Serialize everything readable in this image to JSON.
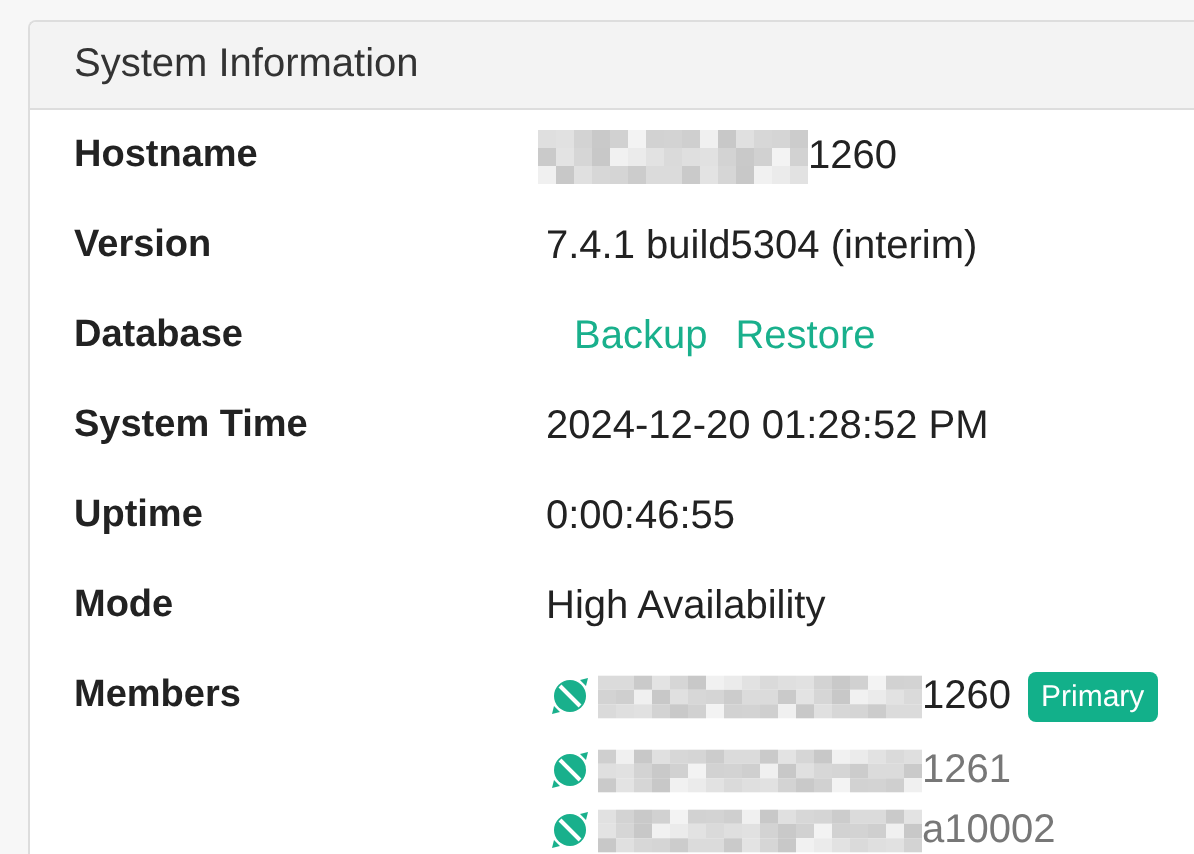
{
  "panel": {
    "title": "System Information"
  },
  "rows": [
    {
      "kind": "text",
      "label": "Hostname",
      "value": "1260",
      "redacted": true
    },
    {
      "kind": "text",
      "label": "Version",
      "value": "7.4.1 build5304 (interim)"
    },
    {
      "kind": "links",
      "label": "Database",
      "links": [
        "Backup",
        "Restore"
      ]
    },
    {
      "kind": "text",
      "label": "System Time",
      "value": "2024-12-20 01:28:52 PM"
    },
    {
      "kind": "text",
      "label": "Uptime",
      "value": "0:00:46:55"
    },
    {
      "kind": "text",
      "label": "Mode",
      "value": "High Availability"
    },
    {
      "kind": "members",
      "label": "Members",
      "members": [
        {
          "name": "1260",
          "redacted": true,
          "current": true,
          "badge": "Primary"
        },
        {
          "name": "1261",
          "redacted": true,
          "current": false
        },
        {
          "name": "a10002",
          "redacted": true,
          "current": false
        }
      ]
    }
  ]
}
